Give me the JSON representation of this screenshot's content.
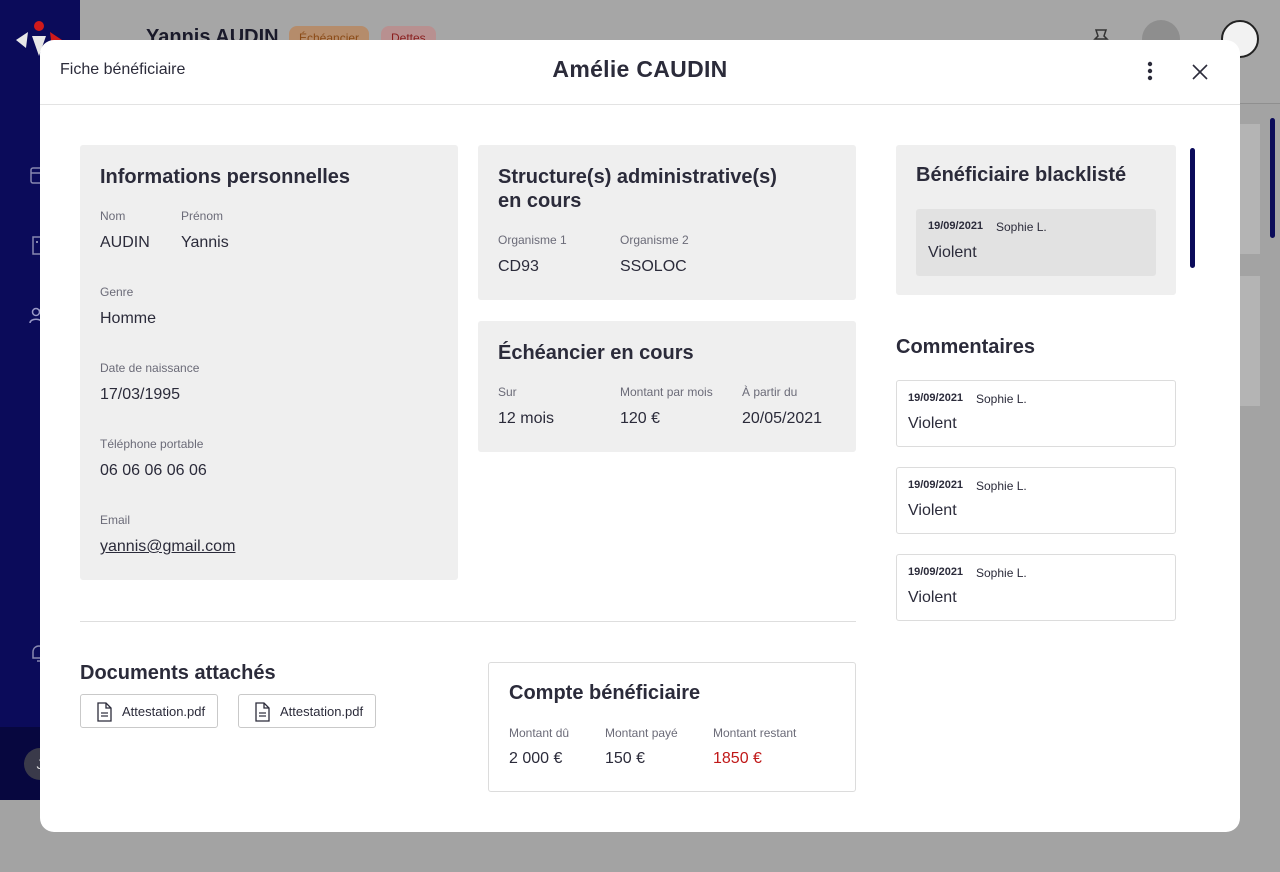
{
  "background": {
    "title": "Yannis AUDIN",
    "chip_schedule": "Échéancier",
    "chip_debts": "Dettes",
    "avatar_initial": "J"
  },
  "modal": {
    "label": "Fiche bénéficiaire",
    "title": "Amélie CAUDIN"
  },
  "personal_info": {
    "title": "Informations personnelles",
    "last_name_label": "Nom",
    "last_name": "AUDIN",
    "first_name_label": "Prénom",
    "first_name": "Yannis",
    "gender_label": "Genre",
    "gender": "Homme",
    "birthdate_label": "Date de naissance",
    "birthdate": "17/03/1995",
    "phone_label": "Téléphone portable",
    "phone": "06 06 06 06 06",
    "email_label": "Email",
    "email": "yannis@gmail.com"
  },
  "admin_structures": {
    "title_line1": "Structure(s) administrative(s)",
    "title_line2": "en cours",
    "org1_label": "Organisme 1",
    "org1": "CD93",
    "org2_label": "Organisme 2",
    "org2": "SSOLOC"
  },
  "schedule": {
    "title": "Échéancier en cours",
    "duration_label": "Sur",
    "duration": "12 mois",
    "monthly_label": "Montant par mois",
    "monthly": "120 €",
    "start_label": "À partir du",
    "start": "20/05/2021"
  },
  "blacklist": {
    "title": "Bénéficiaire blacklisté",
    "note": {
      "date": "19/09/2021",
      "author": "Sophie L.",
      "text": "Violent"
    }
  },
  "comments": {
    "title": "Commentaires",
    "items": [
      {
        "date": "19/09/2021",
        "author": "Sophie L.",
        "text": "Violent"
      },
      {
        "date": "19/09/2021",
        "author": "Sophie L.",
        "text": "Violent"
      },
      {
        "date": "19/09/2021",
        "author": "Sophie L.",
        "text": "Violent"
      }
    ]
  },
  "documents": {
    "title": "Documents attachés",
    "files": [
      "Attestation.pdf",
      "Attestation.pdf"
    ]
  },
  "account": {
    "title": "Compte bénéficiaire",
    "due_label": "Montant dû",
    "due": "2 000 €",
    "paid_label": "Montant payé",
    "paid": "150 €",
    "remaining_label": "Montant restant",
    "remaining": "1850 €"
  },
  "colors": {
    "navy": "#0b0b5a",
    "card_bg": "#efefef",
    "remaining_red": "#c01818"
  }
}
